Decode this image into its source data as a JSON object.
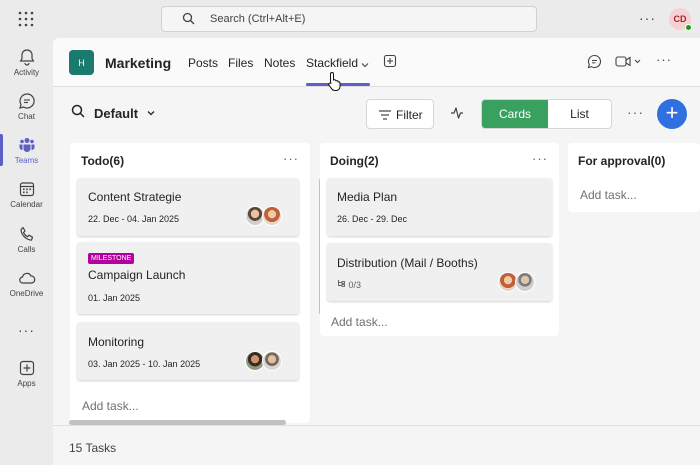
{
  "topbar": {
    "search_placeholder": "Search (Ctrl+Alt+E)",
    "more_label": "···",
    "user_initials": "CD"
  },
  "rail": {
    "items": [
      {
        "label": "Activity",
        "icon": "bell-icon"
      },
      {
        "label": "Chat",
        "icon": "chat-icon"
      },
      {
        "label": "Teams",
        "icon": "teams-icon",
        "active": true
      },
      {
        "label": "Calendar",
        "icon": "calendar-icon"
      },
      {
        "label": "Calls",
        "icon": "phone-icon"
      },
      {
        "label": "OneDrive",
        "icon": "cloud-icon"
      },
      {
        "label": "Apps",
        "icon": "add-app-icon"
      }
    ],
    "more_label": "···"
  },
  "header": {
    "team_initial": "H",
    "team_name": "Marketing",
    "tabs": [
      {
        "label": "Posts"
      },
      {
        "label": "Files"
      },
      {
        "label": "Notes"
      },
      {
        "label": "Stackfield",
        "active": true
      }
    ]
  },
  "toolbar": {
    "view_label": "Default",
    "filter_label": "Filter",
    "cards_label": "Cards",
    "list_label": "List",
    "more_label": "···",
    "add_label": "+"
  },
  "columns": [
    {
      "title": "Todo(6)",
      "more": "···",
      "cards": [
        {
          "title": "Content Strategie",
          "date": "22. Dec - 04. Jan 2025"
        },
        {
          "badge": "MILESTONE",
          "title": "Campaign Launch",
          "date": "01. Jan 2025"
        },
        {
          "title": "Monitoring",
          "date": "03. Jan 2025 - 10. Jan 2025"
        }
      ],
      "add_task": "Add task..."
    },
    {
      "title": "Doing(2)",
      "more": "···",
      "cards": [
        {
          "title": "Media Plan",
          "date": "26. Dec - 29. Dec"
        },
        {
          "title": "Distribution (Mail / Booths)",
          "subtasks": "0/3"
        }
      ],
      "add_task": "Add task..."
    },
    {
      "title": "For approval(0)",
      "cards": [],
      "add_task": "Add task..."
    }
  ],
  "footer": {
    "task_count": "15 Tasks"
  },
  "colors": {
    "accent": "#5b5fc7",
    "cards_toggle": "#3aa060",
    "add_button": "#2f6fdf",
    "milestone": "#b4009e",
    "team_avatar": "#1b7a6e"
  }
}
